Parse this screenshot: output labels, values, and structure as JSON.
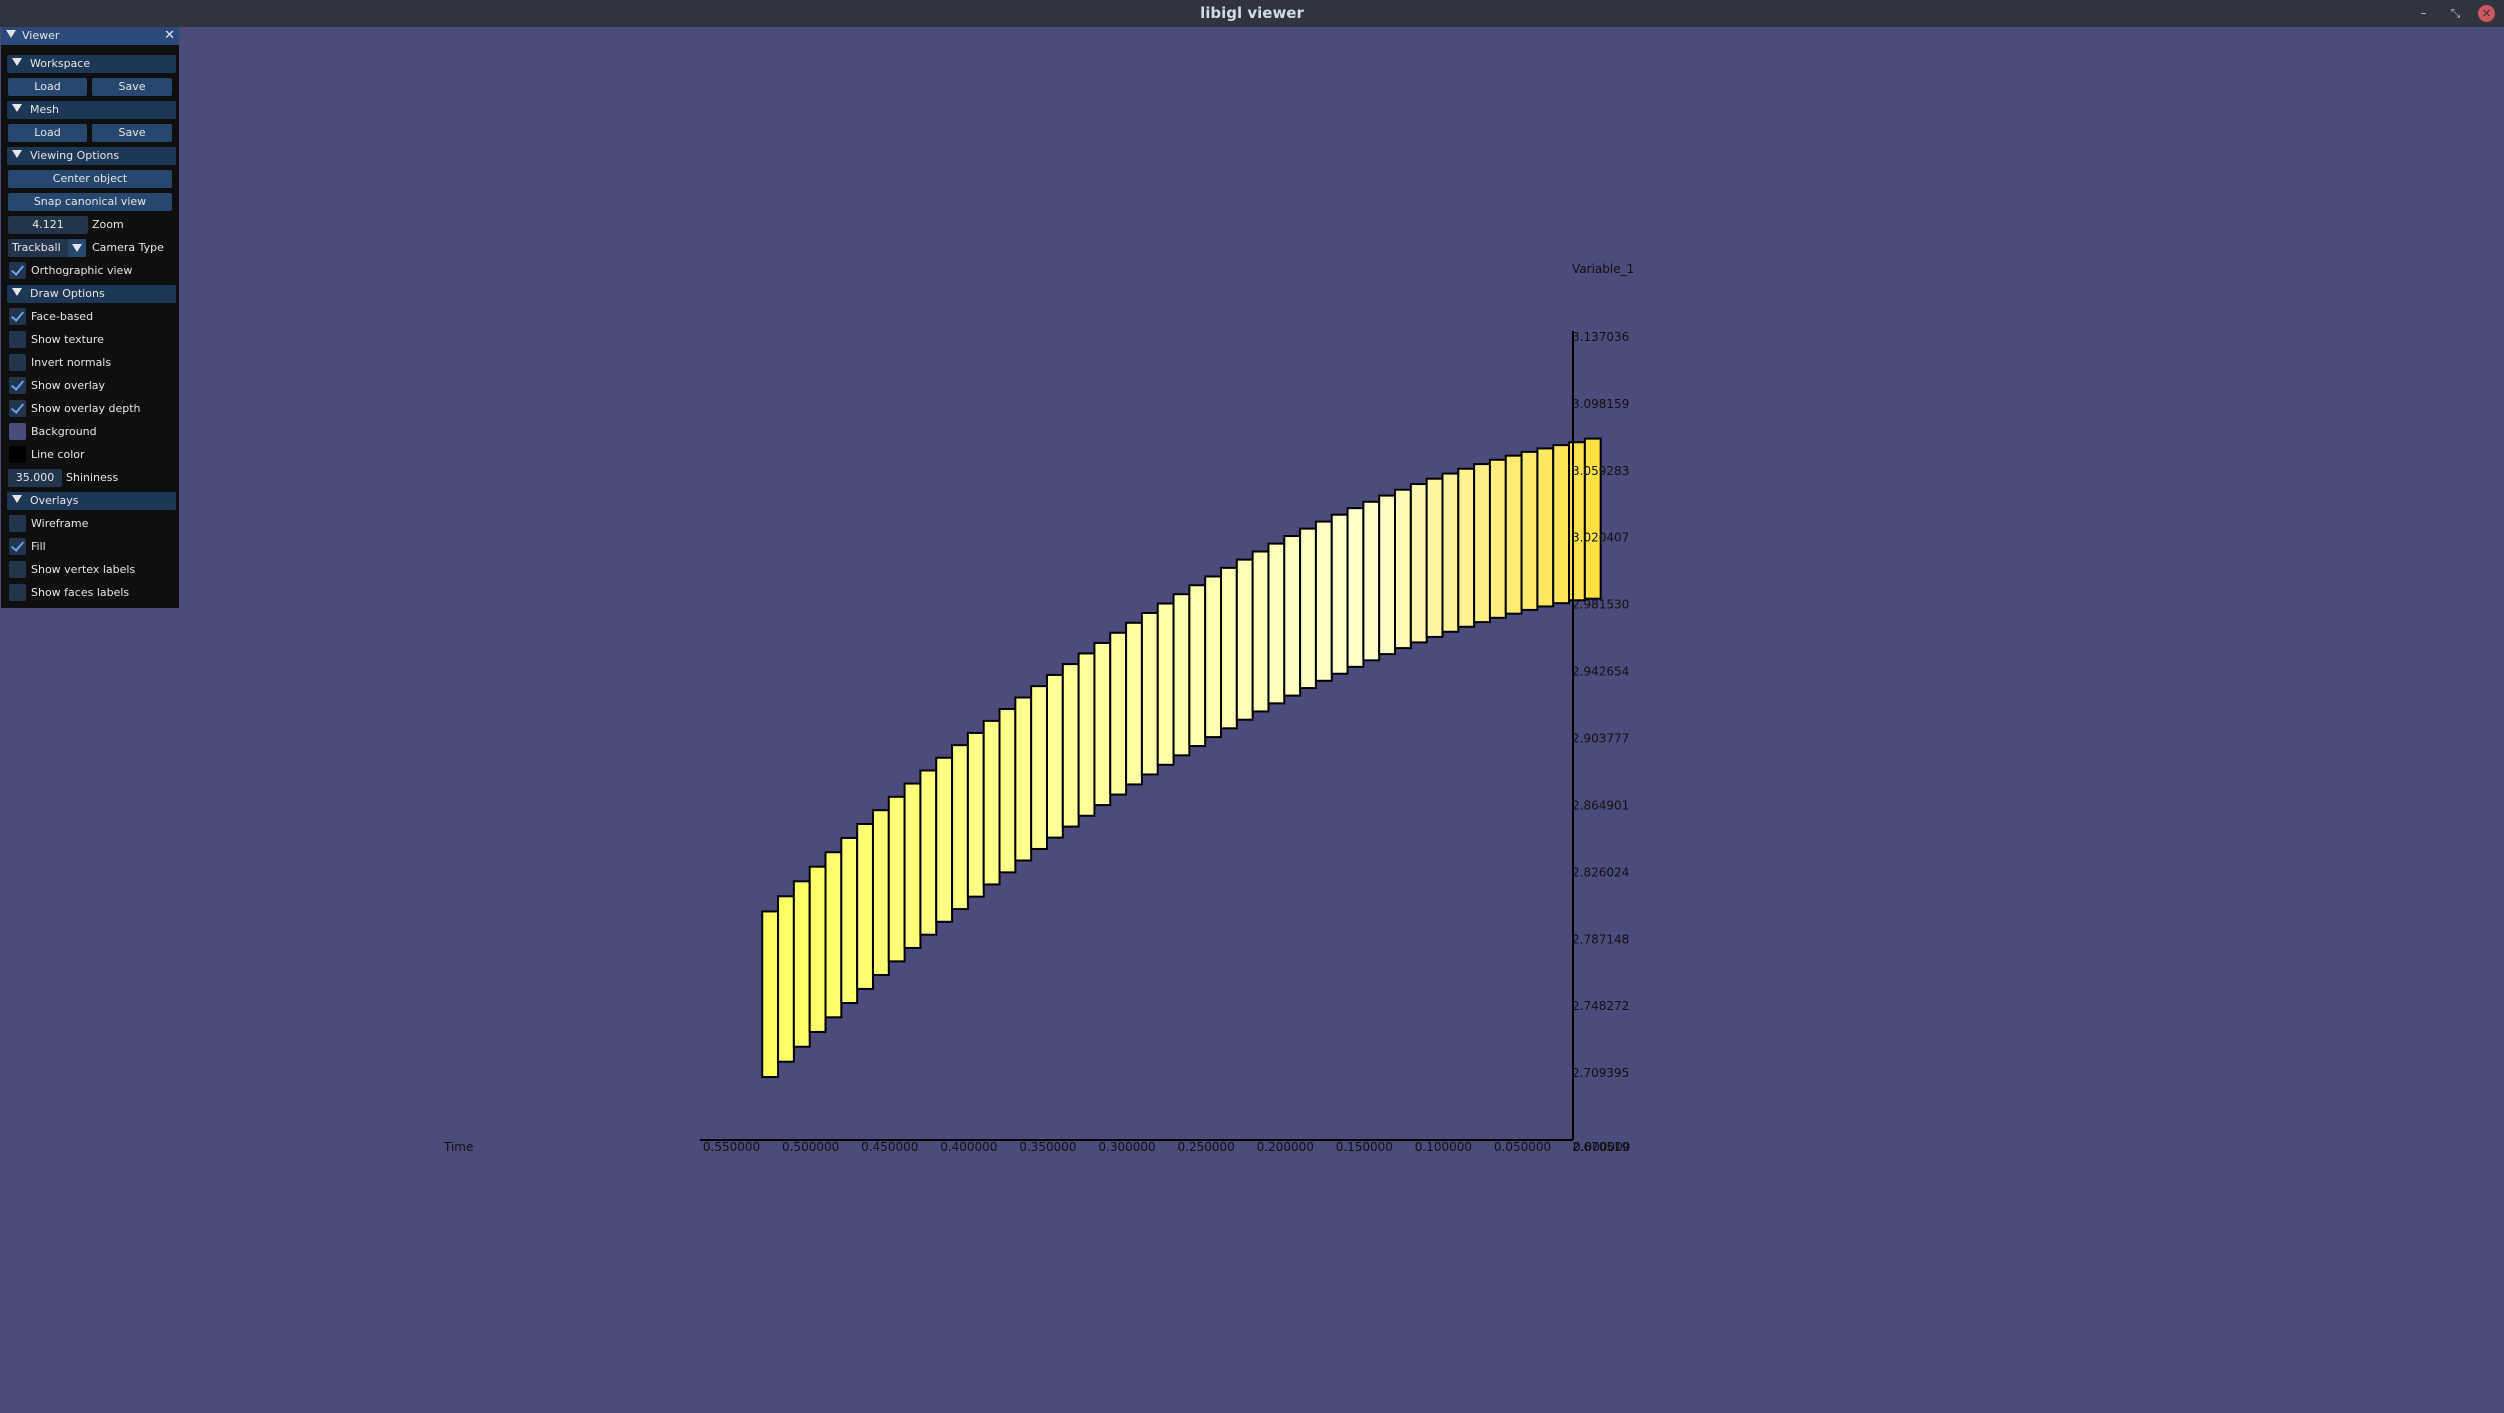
{
  "window": {
    "title": "libigl viewer",
    "minimize_glyph": "–",
    "restore_glyph": "⤡",
    "close_glyph": "✕"
  },
  "viewer_panel": {
    "title": "Viewer",
    "close_glyph": "✕",
    "workspace": {
      "label": "Workspace",
      "load": "Load",
      "save": "Save"
    },
    "mesh": {
      "label": "Mesh",
      "load": "Load",
      "save": "Save"
    },
    "viewing_options": {
      "label": "Viewing Options",
      "center_object": "Center object",
      "snap_canonical_view": "Snap canonical view",
      "zoom_value": "4.121",
      "zoom_label": "Zoom",
      "camera_type_value": "Trackball",
      "camera_type_label": "Camera Type",
      "orthographic_view": {
        "label": "Orthographic view",
        "checked": true
      }
    },
    "draw_options": {
      "label": "Draw Options",
      "face_based": {
        "label": "Face-based",
        "checked": true
      },
      "show_texture": {
        "label": "Show texture",
        "checked": false
      },
      "invert_normals": {
        "label": "Invert normals",
        "checked": false
      },
      "show_overlay": {
        "label": "Show overlay",
        "checked": true
      },
      "show_overlay_depth": {
        "label": "Show overlay depth",
        "checked": true
      },
      "background": {
        "label": "Background",
        "color": "#4b4b7c"
      },
      "line_color": {
        "label": "Line color",
        "color": "#000000"
      },
      "shininess_value": "35.000",
      "shininess_label": "Shininess"
    },
    "overlays": {
      "label": "Overlays",
      "wireframe": {
        "label": "Wireframe",
        "checked": false
      },
      "fill": {
        "label": "Fill",
        "checked": true
      },
      "show_vertex_labels": {
        "label": "Show vertex labels",
        "checked": false
      },
      "show_faces_labels": {
        "label": "Show faces labels",
        "checked": false
      }
    }
  },
  "chart_data": {
    "type": "bar",
    "xlabel": "Time",
    "ylabel": "Variable_1",
    "x_reversed": true,
    "x_ticks": [
      "0.550000",
      "0.500000",
      "0.450000",
      "0.400000",
      "0.350000",
      "0.300000",
      "0.250000",
      "0.200000",
      "0.150000",
      "0.100000",
      "0.050000",
      "0.000000"
    ],
    "y_ticks": [
      "3.137036",
      "3.098159",
      "3.059283",
      "3.020407",
      "2.981530",
      "2.942654",
      "2.903777",
      "2.864901",
      "2.826024",
      "2.787148",
      "2.748272",
      "2.709395"
    ],
    "y_origin_label": "2.670519",
    "xlim": [
      0.0,
      0.55
    ],
    "ylim": [
      2.670519,
      3.137036
    ],
    "bar_fill_colors": {
      "edge": "#ffff60",
      "center": "#ffffcc",
      "last": "#ffe040"
    },
    "bar_outline_color": "#000000",
    "bars": [
      {
        "x_start": 0.5125,
        "x_end": 0.5025,
        "y_low": 2.7071,
        "y_high": 2.8033
      },
      {
        "x_start": 0.5025,
        "x_end": 0.4925,
        "y_low": 2.716,
        "y_high": 2.8121
      },
      {
        "x_start": 0.4925,
        "x_end": 0.4825,
        "y_low": 2.7247,
        "y_high": 2.8208
      },
      {
        "x_start": 0.4825,
        "x_end": 0.4725,
        "y_low": 2.7333,
        "y_high": 2.8293
      },
      {
        "x_start": 0.4725,
        "x_end": 0.4625,
        "y_low": 2.7418,
        "y_high": 2.8377
      },
      {
        "x_start": 0.4625,
        "x_end": 0.4525,
        "y_low": 2.7501,
        "y_high": 2.846
      },
      {
        "x_start": 0.4525,
        "x_end": 0.4425,
        "y_low": 2.7583,
        "y_high": 2.8541
      },
      {
        "x_start": 0.4425,
        "x_end": 0.4325,
        "y_low": 2.7664,
        "y_high": 2.8621
      },
      {
        "x_start": 0.4325,
        "x_end": 0.4225,
        "y_low": 2.7743,
        "y_high": 2.8699
      },
      {
        "x_start": 0.4225,
        "x_end": 0.4125,
        "y_low": 2.7821,
        "y_high": 2.8776
      },
      {
        "x_start": 0.4125,
        "x_end": 0.4025,
        "y_low": 2.7898,
        "y_high": 2.8852
      },
      {
        "x_start": 0.4025,
        "x_end": 0.3925,
        "y_low": 2.7973,
        "y_high": 2.8926
      },
      {
        "x_start": 0.3925,
        "x_end": 0.3825,
        "y_low": 2.8047,
        "y_high": 2.8999
      },
      {
        "x_start": 0.3825,
        "x_end": 0.3725,
        "y_low": 2.8119,
        "y_high": 2.907
      },
      {
        "x_start": 0.3725,
        "x_end": 0.3625,
        "y_low": 2.819,
        "y_high": 2.914
      },
      {
        "x_start": 0.3625,
        "x_end": 0.3525,
        "y_low": 2.826,
        "y_high": 2.9209
      },
      {
        "x_start": 0.3525,
        "x_end": 0.3425,
        "y_low": 2.8329,
        "y_high": 2.9276
      },
      {
        "x_start": 0.3425,
        "x_end": 0.3325,
        "y_low": 2.8396,
        "y_high": 2.9342
      },
      {
        "x_start": 0.3325,
        "x_end": 0.3225,
        "y_low": 2.8462,
        "y_high": 2.9407
      },
      {
        "x_start": 0.3225,
        "x_end": 0.3125,
        "y_low": 2.8526,
        "y_high": 2.947
      },
      {
        "x_start": 0.3125,
        "x_end": 0.3025,
        "y_low": 2.8589,
        "y_high": 2.9532
      },
      {
        "x_start": 0.3025,
        "x_end": 0.2925,
        "y_low": 2.8651,
        "y_high": 2.9593
      },
      {
        "x_start": 0.2925,
        "x_end": 0.2825,
        "y_low": 2.8712,
        "y_high": 2.9652
      },
      {
        "x_start": 0.2825,
        "x_end": 0.2725,
        "y_low": 2.8771,
        "y_high": 2.971
      },
      {
        "x_start": 0.2725,
        "x_end": 0.2625,
        "y_low": 2.8829,
        "y_high": 2.9767
      },
      {
        "x_start": 0.2625,
        "x_end": 0.2525,
        "y_low": 2.8885,
        "y_high": 2.9822
      },
      {
        "x_start": 0.2525,
        "x_end": 0.2425,
        "y_low": 2.894,
        "y_high": 2.9876
      },
      {
        "x_start": 0.2425,
        "x_end": 0.2325,
        "y_low": 2.8994,
        "y_high": 2.9928
      },
      {
        "x_start": 0.2325,
        "x_end": 0.2225,
        "y_low": 2.9046,
        "y_high": 2.9979
      },
      {
        "x_start": 0.2225,
        "x_end": 0.2125,
        "y_low": 2.9097,
        "y_high": 3.0029
      },
      {
        "x_start": 0.2125,
        "x_end": 0.2025,
        "y_low": 2.9147,
        "y_high": 3.0077
      },
      {
        "x_start": 0.2025,
        "x_end": 0.1925,
        "y_low": 2.9195,
        "y_high": 3.0124
      },
      {
        "x_start": 0.1925,
        "x_end": 0.1825,
        "y_low": 2.9242,
        "y_high": 3.017
      },
      {
        "x_start": 0.1825,
        "x_end": 0.1725,
        "y_low": 2.9287,
        "y_high": 3.0214
      },
      {
        "x_start": 0.1725,
        "x_end": 0.1625,
        "y_low": 2.9331,
        "y_high": 3.0257
      },
      {
        "x_start": 0.1625,
        "x_end": 0.1525,
        "y_low": 2.9373,
        "y_high": 3.0298
      },
      {
        "x_start": 0.1525,
        "x_end": 0.1425,
        "y_low": 2.9414,
        "y_high": 3.0338
      },
      {
        "x_start": 0.1425,
        "x_end": 0.1325,
        "y_low": 2.9454,
        "y_high": 3.0376
      },
      {
        "x_start": 0.1325,
        "x_end": 0.1225,
        "y_low": 2.9492,
        "y_high": 3.0413
      },
      {
        "x_start": 0.1225,
        "x_end": 0.1125,
        "y_low": 2.9528,
        "y_high": 3.0449
      },
      {
        "x_start": 0.1125,
        "x_end": 0.1025,
        "y_low": 2.9563,
        "y_high": 3.0483
      },
      {
        "x_start": 0.1025,
        "x_end": 0.0925,
        "y_low": 2.9596,
        "y_high": 3.0516
      },
      {
        "x_start": 0.0925,
        "x_end": 0.0825,
        "y_low": 2.9628,
        "y_high": 3.0547
      },
      {
        "x_start": 0.0825,
        "x_end": 0.0725,
        "y_low": 2.9658,
        "y_high": 3.0577
      },
      {
        "x_start": 0.0725,
        "x_end": 0.0625,
        "y_low": 2.9687,
        "y_high": 3.0605
      },
      {
        "x_start": 0.0625,
        "x_end": 0.0525,
        "y_low": 2.9714,
        "y_high": 3.0632
      },
      {
        "x_start": 0.0525,
        "x_end": 0.0425,
        "y_low": 2.9739,
        "y_high": 3.0657
      },
      {
        "x_start": 0.0425,
        "x_end": 0.0325,
        "y_low": 2.9763,
        "y_high": 3.0681
      },
      {
        "x_start": 0.0325,
        "x_end": 0.0225,
        "y_low": 2.9785,
        "y_high": 3.0703
      },
      {
        "x_start": 0.0225,
        "x_end": 0.0125,
        "y_low": 2.9805,
        "y_high": 3.0723
      },
      {
        "x_start": 0.0125,
        "x_end": 0.0025,
        "y_low": 2.9824,
        "y_high": 3.0742
      },
      {
        "x_start": 0.0025,
        "x_end": -0.0075,
        "y_low": 2.9841,
        "y_high": 3.0759
      },
      {
        "x_start": -0.0075,
        "x_end": -0.0175,
        "y_low": 2.985,
        "y_high": 3.078
      }
    ]
  }
}
